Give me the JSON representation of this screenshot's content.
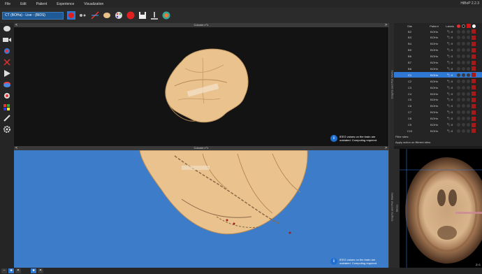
{
  "app": {
    "title": "HiBoP 2.2.3"
  },
  "menu": [
    {
      "label": "File"
    },
    {
      "label": "Edit"
    },
    {
      "label": "Patient"
    },
    {
      "label": "Experience"
    },
    {
      "label": "Visualization"
    }
  ],
  "toolbar": {
    "visualization_selector": "CT (BOHa) - Live - (BIDS)"
  },
  "columns": [
    {
      "title": "Column n°1"
    },
    {
      "title": "Column n°1"
    }
  ],
  "notices": [
    {
      "line1": "IEEG values on the brain are",
      "line2": "outdated. Computing required."
    },
    {
      "line1": "IEEG values on the brain are",
      "line2": "outdated. Computing required."
    }
  ],
  "side_tabs": {
    "sites": "Graphs and Plot Marks",
    "cuts": "Graphs and Plot Marks",
    "mri_view": "Slices"
  },
  "sites_table": {
    "headers": {
      "site": "Site",
      "patient": "Patient",
      "labels": "Labels"
    },
    "header_colors": [
      "#e03030",
      "#111111",
      "#d41616",
      "#ffffff"
    ],
    "rows": [
      {
        "site": "B2",
        "patient": "BOHn",
        "count": "0"
      },
      {
        "site": "B3",
        "patient": "BOHn",
        "count": "0"
      },
      {
        "site": "B4",
        "patient": "BOHn",
        "count": "0"
      },
      {
        "site": "B5",
        "patient": "BOHn",
        "count": "0"
      },
      {
        "site": "B6",
        "patient": "BOHn",
        "count": "0"
      },
      {
        "site": "B7",
        "patient": "BOHn",
        "count": "0"
      },
      {
        "site": "B8",
        "patient": "BOHn",
        "count": "0"
      },
      {
        "site": "C1",
        "patient": "BOHn",
        "count": "0",
        "selected": true
      },
      {
        "site": "C2",
        "patient": "BOHn",
        "count": "0"
      },
      {
        "site": "C3",
        "patient": "BOHn",
        "count": "0"
      },
      {
        "site": "C4",
        "patient": "BOHn",
        "count": "0"
      },
      {
        "site": "C5",
        "patient": "BOHn",
        "count": "0"
      },
      {
        "site": "C6",
        "patient": "BOHn",
        "count": "0"
      },
      {
        "site": "C7",
        "patient": "BOHn",
        "count": "0"
      },
      {
        "site": "C8",
        "patient": "BOHn",
        "count": "0"
      },
      {
        "site": "C9",
        "patient": "BOHn",
        "count": "0"
      },
      {
        "site": "C10",
        "patient": "BOHn",
        "count": "0"
      }
    ],
    "filter_label": "Filter sites:",
    "filter_action": "Apply action on filtered sites:"
  },
  "mri_view": {
    "slice_label": "Z=1"
  },
  "colors": {
    "accent": "#2f78d3",
    "brain": "#e9c28e",
    "viewport_bottom_bg": "#3c7cc8",
    "site_marker": "#a81a1a"
  }
}
